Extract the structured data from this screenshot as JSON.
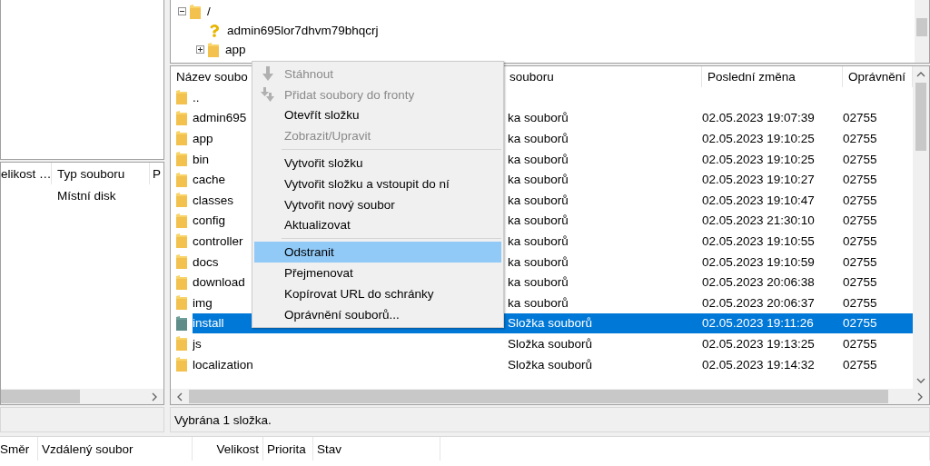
{
  "remote_tree": {
    "items": [
      {
        "label": "/",
        "kind": "folder",
        "expanded": true,
        "children": [
          {
            "label": "admin695lor7dhvm79bhqcrj",
            "kind": "unknown"
          },
          {
            "label": "app",
            "kind": "folder",
            "expanded": false
          }
        ]
      }
    ]
  },
  "local_list": {
    "columns": [
      "elikost …",
      "Typ souboru",
      "P"
    ],
    "rows": [
      {
        "type": "Místní disk"
      }
    ]
  },
  "remote_list": {
    "columns": [
      "Název soubo",
      "souboru",
      "Poslední změna",
      "Oprávnění"
    ],
    "rows": [
      {
        "name": "..",
        "selected": false
      },
      {
        "name": "admin695",
        "type": "ka souborů",
        "modified": "02.05.2023 19:07:39",
        "permissions": "02755",
        "selected": false
      },
      {
        "name": "app",
        "type": "ka souborů",
        "modified": "02.05.2023 19:10:25",
        "permissions": "02755",
        "selected": false
      },
      {
        "name": "bin",
        "type": "ka souborů",
        "modified": "02.05.2023 19:10:25",
        "permissions": "02755",
        "selected": false
      },
      {
        "name": "cache",
        "type": "ka souborů",
        "modified": "02.05.2023 19:10:27",
        "permissions": "02755",
        "selected": false
      },
      {
        "name": "classes",
        "type": "ka souborů",
        "modified": "02.05.2023 19:10:47",
        "permissions": "02755",
        "selected": false
      },
      {
        "name": "config",
        "type": "ka souborů",
        "modified": "02.05.2023 21:30:10",
        "permissions": "02755",
        "selected": false
      },
      {
        "name": "controller",
        "type": "ka souborů",
        "modified": "02.05.2023 19:10:55",
        "permissions": "02755",
        "selected": false
      },
      {
        "name": "docs",
        "type": "ka souborů",
        "modified": "02.05.2023 19:10:59",
        "permissions": "02755",
        "selected": false
      },
      {
        "name": "download",
        "type": "ka souborů",
        "modified": "02.05.2023 20:06:38",
        "permissions": "02755",
        "selected": false
      },
      {
        "name": "img",
        "type": "ka souborů",
        "modified": "02.05.2023 20:06:37",
        "permissions": "02755",
        "selected": false
      },
      {
        "name": "install",
        "type": "Složka souborů",
        "modified": "02.05.2023 19:11:26",
        "permissions": "02755",
        "selected": true
      },
      {
        "name": "js",
        "type": "Složka souborů",
        "modified": "02.05.2023 19:13:25",
        "permissions": "02755",
        "selected": false
      },
      {
        "name": "localization",
        "type": "Složka souborů",
        "modified": "02.05.2023 19:14:32",
        "permissions": "02755",
        "selected": false
      }
    ]
  },
  "remote_status": "Vybrána 1 složka.",
  "queue": {
    "columns": [
      "Směr",
      "Vzdálený soubor",
      "Velikost",
      "Priorita",
      "Stav"
    ]
  },
  "context_menu": {
    "items": [
      {
        "kind": "download",
        "label": "Stáhnout",
        "disabled": true,
        "selected": false
      },
      {
        "kind": "queue",
        "label": "Přidat soubory do fronty",
        "disabled": true,
        "selected": false
      },
      {
        "kind": "item",
        "label": "Otevřít složku",
        "disabled": false,
        "selected": false
      },
      {
        "kind": "item",
        "label": "Zobrazit/Upravit",
        "disabled": true,
        "selected": false
      },
      {
        "kind": "separator"
      },
      {
        "kind": "item",
        "label": "Vytvořit složku",
        "disabled": false,
        "selected": false
      },
      {
        "kind": "item",
        "label": "Vytvořit složku a vstoupit do ní",
        "disabled": false,
        "selected": false
      },
      {
        "kind": "item",
        "label": "Vytvořit nový soubor",
        "disabled": false,
        "selected": false
      },
      {
        "kind": "item",
        "label": "Aktualizovat",
        "disabled": false,
        "selected": false
      },
      {
        "kind": "separator"
      },
      {
        "kind": "item",
        "label": "Odstranit",
        "disabled": false,
        "selected": true
      },
      {
        "kind": "item",
        "label": "Přejmenovat",
        "disabled": false,
        "selected": false
      },
      {
        "kind": "item",
        "label": "Kopírovat URL do schránky",
        "disabled": false,
        "selected": false
      },
      {
        "kind": "item",
        "label": "Oprávnění souborů...",
        "disabled": false,
        "selected": false
      }
    ]
  }
}
